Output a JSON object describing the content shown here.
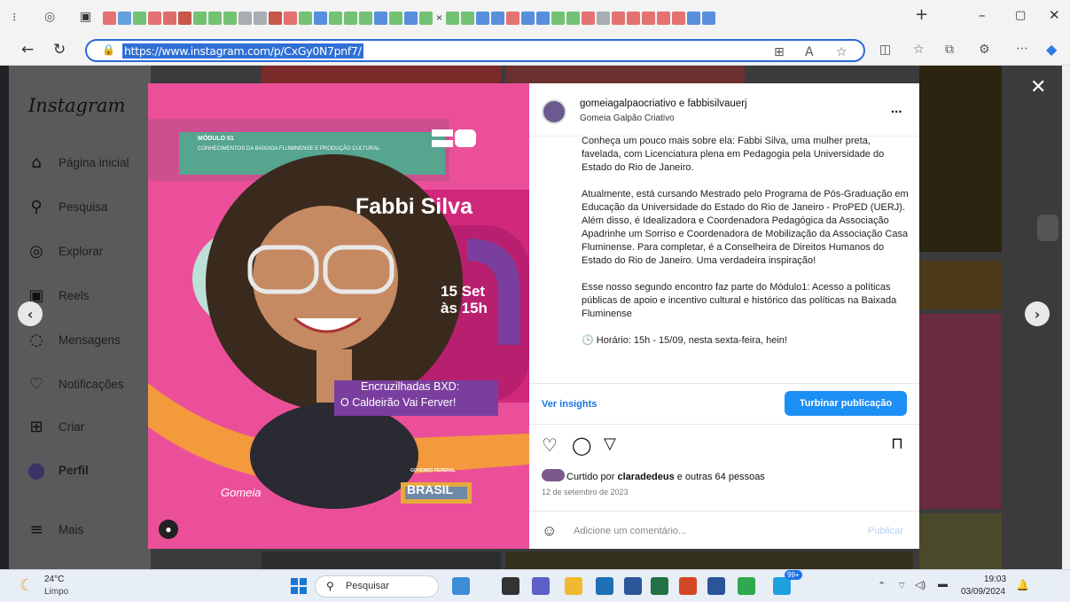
{
  "browser": {
    "url": "https://www.instagram.com/p/CxGy0N7pnf7/",
    "tab_close": "×",
    "new_tab": "+",
    "minimize": "–",
    "maximize": "▢",
    "close": "✕"
  },
  "sidebar": {
    "logo": "Instagram",
    "items": [
      {
        "label": "Página inicial",
        "icon": "home-icon"
      },
      {
        "label": "Pesquisa",
        "icon": "search-icon"
      },
      {
        "label": "Explorar",
        "icon": "compass-icon"
      },
      {
        "label": "Reels",
        "icon": "reels-icon"
      },
      {
        "label": "Mensagens",
        "icon": "messenger-icon"
      },
      {
        "label": "Notificações",
        "icon": "heart-icon"
      },
      {
        "label": "Criar",
        "icon": "plus-square-icon"
      },
      {
        "label": "Perfil",
        "icon": "profile-avatar"
      },
      {
        "label": "Mais",
        "icon": "menu-icon"
      }
    ]
  },
  "post_image": {
    "module": "MÓDULO 01",
    "module_sub": "CONHECIMENTOS DA BAIXADA FLUMINENSE E PRODUÇÃO CULTURAL",
    "name": "Fabbi Silva",
    "date": "15 Set",
    "time": "às 15h",
    "event1": "Encruzilhadas BXD:",
    "event2": "O Caldeirão Vai Ferver!",
    "brand": "Gomeia",
    "footer1": "GOVERNO FEDERAL",
    "footer2": "BRASIL"
  },
  "post": {
    "username": "gomeiagalpaocriativo e fabbisilvauerj",
    "subtitle": "Gomeia Galpão Criativo",
    "more": "...",
    "caption": [
      "Conheça um pouco mais sobre ela: Fabbi Silva, uma mulher preta, favelada, com Licenciatura plena em Pedagogia pela Universidade do Estado do Rio de Janeiro.",
      "Atualmente, está cursando Mestrado pelo Programa de Pós-Graduação em Educação da Universidade do Estado do Rio de Janeiro - ProPED (UERJ). Além disso, é Idealizadora e Coordenadora Pedagógica da Associação Apadrinhe um Sorriso e Coordenadora de Mobilização da Associação Casa Fluminense. Para completar, é a Conselheira de Direitos Humanos do Estado do Rio de Janeiro. Uma verdadeira inspiração!",
      "Esse nosso segundo encontro faz parte do Módulo1: Acesso a políticas públicas de apoio e incentivo cultural e histórico das políticas na Baixada Fluminense",
      "🕒 Horário: 15h - 15/09, nesta sexta-feira, hein!"
    ],
    "insights": "Ver insights",
    "boost": "Turbinar publicação",
    "likes_prefix": "Curtido por ",
    "likes_user": "claradedeus",
    "likes_suffix": " e outras 64 pessoas",
    "date": "12 de setembro de 2023",
    "comment_placeholder": "Adicione um comentário...",
    "publish": "Publicar"
  },
  "taskbar": {
    "temp": "24°C",
    "weather": "Limpo",
    "search": "Pesquisar",
    "time": "19:03",
    "date": "03/09/2024",
    "badge": "99+"
  },
  "colors": {
    "accent": "#1c8ff5",
    "pink": "#ec4f9a",
    "purple": "#7a3f9e"
  }
}
